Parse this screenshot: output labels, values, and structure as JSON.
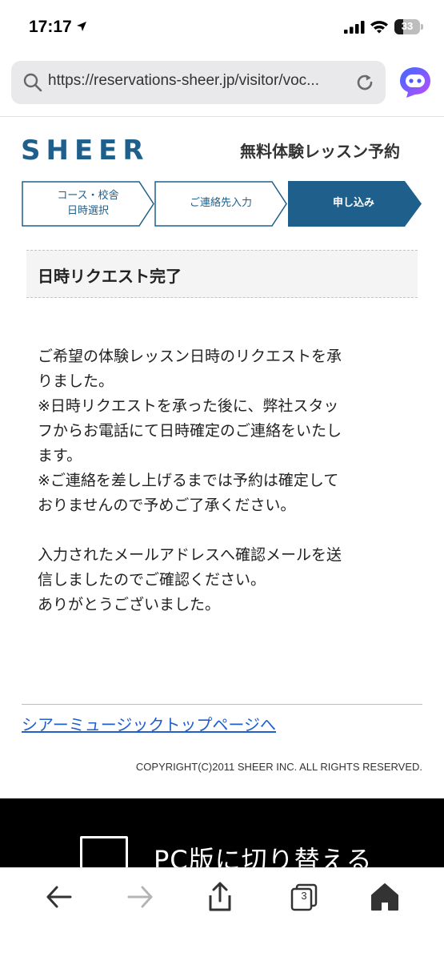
{
  "status_bar": {
    "time": "17:17",
    "battery_level": "33",
    "battery_fraction": 0.33
  },
  "browser": {
    "url": "https://reservations-sheer.jp/visitor/voc...",
    "tabs_count": "3"
  },
  "site": {
    "logo_text": "SHEER",
    "brand_color": "#1f5f8b",
    "page_title": "無料体験レッスン予約"
  },
  "steps": [
    {
      "label": "コース・校舎\n日時選択",
      "active": false
    },
    {
      "label": "ご連絡先入力",
      "active": false
    },
    {
      "label": "申し込み",
      "active": true
    }
  ],
  "section": {
    "title": "日時リクエスト完了"
  },
  "message": {
    "paragraph_1": "ご希望の体験レッスン日時のリクエストを承\nりました。\n※日時リクエストを承った後に、弊社スタッ\nフからお電話にて日時確定のご連絡をいたし\nます。\n※ご連絡を差し上げるまでは予約は確定して\nおりませんので予めご了承ください。",
    "paragraph_2": "入力されたメールアドレスへ確認メールを送\n信しましたのでご確認ください。\nありがとうございました。"
  },
  "footer": {
    "top_link": "シアーミュージックトップページへ",
    "copyright": "COPYRIGHT(C)2011 SHEER INC. ALL RIGHTS RESERVED."
  },
  "banner": {
    "pc_switch": "PC版に切り替える"
  },
  "icons": {
    "location": "location-arrow-icon",
    "signal": "cellular-signal-icon",
    "wifi": "wifi-icon",
    "battery": "battery-icon",
    "search": "search-icon",
    "reload": "reload-icon",
    "assistant": "assistant-icon",
    "back": "back-arrow-icon",
    "forward": "forward-arrow-icon",
    "share": "share-icon",
    "tabs": "tabs-icon",
    "home": "home-icon",
    "monitor": "monitor-icon"
  }
}
